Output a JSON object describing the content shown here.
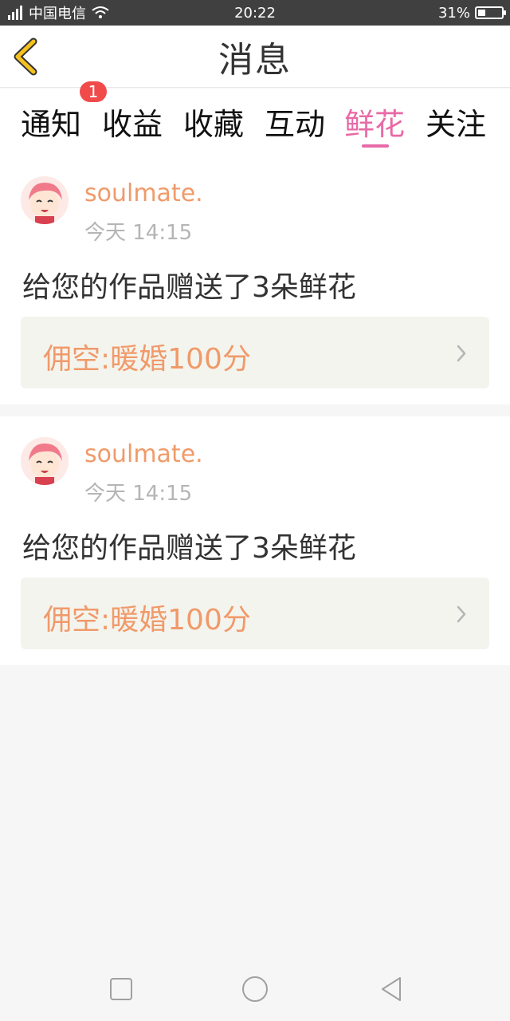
{
  "status": {
    "network": "4G",
    "carrier": "中国电信",
    "time": "20:22",
    "battery": "31%",
    "battery_level": 0.31
  },
  "header": {
    "title": "消息",
    "back_icon": "chevron-left-icon"
  },
  "tabs": [
    {
      "label": "通知"
    },
    {
      "label": "收益"
    },
    {
      "label": "收藏"
    },
    {
      "label": "互动"
    },
    {
      "label": "鲜花"
    },
    {
      "label": "关注"
    }
  ],
  "active_tab": "鲜花",
  "badge": {
    "count": "1"
  },
  "messages": [
    {
      "username": "soulmate.",
      "time": "今天 14:15",
      "text": "给您的作品赠送了3朵鲜花",
      "work_title": "佣空:暖婚100分"
    },
    {
      "username": "soulmate.",
      "time": "今天 14:15",
      "text": "给您的作品赠送了3朵鲜花",
      "work_title": "佣空:暖婚100分"
    }
  ],
  "colors": {
    "accent_pink": "#e86aa6",
    "accent_orange": "#f09a6a",
    "back_yellow": "#f4c11f"
  }
}
